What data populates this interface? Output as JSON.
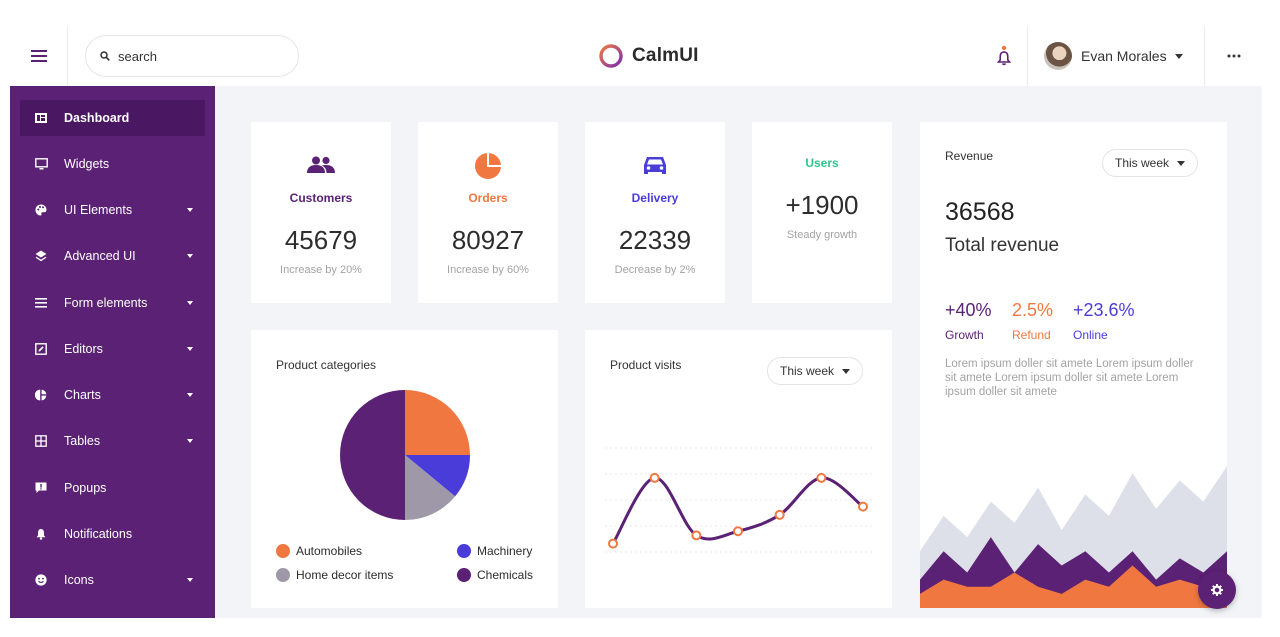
{
  "header": {
    "search_placeholder": "search",
    "brand": "CalmUI",
    "user_name": "Evan Morales",
    "menu_icon": "hamburger-icon",
    "more_icon": "more-horizontal-icon"
  },
  "sidebar": {
    "items": [
      {
        "label": "Dashboard",
        "icon": "dashboard-icon",
        "active": true,
        "has_submenu": false
      },
      {
        "label": "Widgets",
        "icon": "monitor-icon",
        "has_submenu": false
      },
      {
        "label": "UI Elements",
        "icon": "palette-icon",
        "has_submenu": true
      },
      {
        "label": "Advanced UI",
        "icon": "layers-icon",
        "has_submenu": true
      },
      {
        "label": "Form elements",
        "icon": "form-icon",
        "has_submenu": true
      },
      {
        "label": "Editors",
        "icon": "edit-icon",
        "has_submenu": true
      },
      {
        "label": "Charts",
        "icon": "pie-chart-icon",
        "has_submenu": true
      },
      {
        "label": "Tables",
        "icon": "table-icon",
        "has_submenu": true
      },
      {
        "label": "Popups",
        "icon": "message-icon",
        "has_submenu": false
      },
      {
        "label": "Notifications",
        "icon": "bell-icon",
        "has_submenu": false
      },
      {
        "label": "Icons",
        "icon": "smiley-icon",
        "has_submenu": true
      }
    ]
  },
  "stats": [
    {
      "label": "Customers",
      "value": "45679",
      "sub": "Increase by 20%",
      "color": "#5b2174",
      "icon": "users-icon"
    },
    {
      "label": "Orders",
      "value": "80927",
      "sub": "Increase by 60%",
      "color": "#f07840",
      "icon": "pie-icon"
    },
    {
      "label": "Delivery",
      "value": "22339",
      "sub": "Decrease by 2%",
      "color": "#4a3cd8",
      "icon": "car-icon"
    },
    {
      "label": "Users",
      "value": "+1900",
      "sub": "Steady growth",
      "color": "#2ec48f"
    }
  ],
  "revenue": {
    "title": "Revenue",
    "period": "This week",
    "value": "36568",
    "caption": "Total revenue",
    "metrics": [
      {
        "value": "+40%",
        "label": "Growth",
        "value_color": "#5b2174",
        "label_color": "#5b2174"
      },
      {
        "value": "2.5%",
        "label": "Refund",
        "value_color": "#f07840",
        "label_color": "#f07840"
      },
      {
        "value": "+23.6%",
        "label": "Online",
        "value_color": "#4a3cd8",
        "label_color": "#4a3cd8"
      }
    ],
    "description": "Lorem ipsum doller sit amete Lorem ipsum doller sit amete Lorem ipsum doller sit amete Lorem ipsum doller sit amete"
  },
  "product_categories": {
    "title": "Product categories",
    "legend": [
      {
        "label": "Automobiles",
        "color": "#f07840"
      },
      {
        "label": "Machinery",
        "color": "#4a3cd8"
      },
      {
        "label": "Home decor items",
        "color": "#9e98a8"
      },
      {
        "label": "Chemicals",
        "color": "#5b2174"
      }
    ]
  },
  "product_visits": {
    "title": "Product visits",
    "period": "This week"
  },
  "chart_data": [
    {
      "type": "pie",
      "categories": [
        "Automobiles",
        "Machinery",
        "Home decor items",
        "Chemicals"
      ],
      "values": [
        25,
        11,
        14,
        50
      ],
      "colors": [
        "#f07840",
        "#4a3cd8",
        "#9e98a8",
        "#5b2174"
      ],
      "legend": "bottom"
    },
    {
      "type": "line",
      "x": [
        1,
        2,
        3,
        4,
        5,
        6,
        7
      ],
      "y": [
        2,
        10,
        3,
        3.5,
        5.5,
        10,
        6.5
      ],
      "ylim": [
        0,
        14
      ],
      "grid": true,
      "line_color": "#5b2174",
      "marker_color": "#f07840"
    },
    {
      "type": "area",
      "series": [
        {
          "values": [
            8,
            13,
            10,
            15,
            12,
            17,
            11,
            16,
            13,
            19,
            14,
            18,
            15,
            20
          ],
          "color": "#dde0e8"
        },
        {
          "values": [
            4,
            8,
            5,
            10,
            5,
            9,
            6,
            8,
            5,
            8,
            4,
            7,
            5,
            8
          ],
          "color": "#5b2174"
        },
        {
          "values": [
            2,
            4,
            3,
            3,
            5,
            3,
            2,
            4,
            3,
            6,
            3,
            4,
            3,
            4
          ],
          "color": "#f07840"
        }
      ],
      "grid": false
    }
  ]
}
